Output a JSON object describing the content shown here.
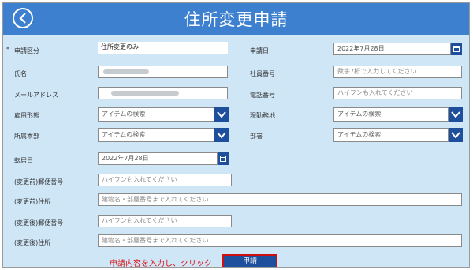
{
  "header": {
    "title": "住所変更申請",
    "back_icon": "chevron-left-icon"
  },
  "colors": {
    "header": "#3c80cf",
    "background": "#cfe6f7",
    "accent": "#1d4f9c",
    "alert": "#e01010"
  },
  "form": {
    "required_mark": "*",
    "application_type": {
      "label": "申請区分",
      "value": "住所変更のみ"
    },
    "application_date": {
      "label": "申請日",
      "value": "2022年7月28日"
    },
    "name": {
      "label": "氏名"
    },
    "employee_no": {
      "label": "社員番号",
      "placeholder": "数字7桁で入力してください"
    },
    "email": {
      "label": "メールアドレス"
    },
    "phone": {
      "label": "電話番号",
      "placeholder": "ハイフンも入れてください"
    },
    "employment_type": {
      "label": "雇用形態",
      "placeholder": "アイテムの検索"
    },
    "work_location": {
      "label": "現勤務地",
      "placeholder": "アイテムの検索"
    },
    "division": {
      "label": "所属本部",
      "placeholder": "アイテムの検索"
    },
    "department": {
      "label": "部署",
      "placeholder": "アイテムの検索"
    },
    "move_date": {
      "label": "転居日",
      "value": "2022年7月28日"
    },
    "old_zip": {
      "label": "(変更前)郵便番号",
      "placeholder": "ハイフンも入れてください"
    },
    "old_address": {
      "label": "(変更前)住所",
      "placeholder": "建物名・部屋番号まで入れてください"
    },
    "new_zip": {
      "label": "(変更後)郵便番号",
      "placeholder": "ハイフンも入れてください"
    },
    "new_address": {
      "label": "(変更後)住所",
      "placeholder": "建物名・部屋番号まで入れてください"
    }
  },
  "footer": {
    "hint": "申請内容を入力し、クリック",
    "submit_label": "申請"
  }
}
